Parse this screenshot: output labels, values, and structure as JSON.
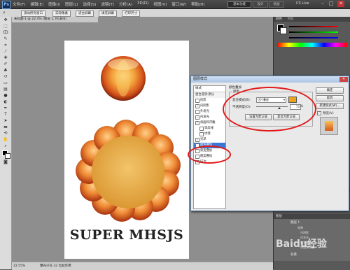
{
  "app": {
    "logo": "Ps"
  },
  "menubar": {
    "menus": [
      "文件(F)",
      "编辑(E)",
      "图像(I)",
      "图层(L)",
      "选择(S)",
      "滤镜(T)",
      "分析(A)",
      "3D(D)",
      "视图(V)",
      "窗口(W)",
      "帮助(H)"
    ],
    "workspace": "基本功能",
    "ws_design": "设计",
    "ws_paint": "绘画",
    "cs_live": "CS Live",
    "minimize": "–",
    "maximize": "□",
    "close": "✕"
  },
  "optbar": {
    "b1": "滚动所有窗口",
    "b2": "实际像素",
    "b3": "适合屏幕",
    "b4": "填充屏幕",
    "b5": "打印尺寸"
  },
  "document": {
    "tab": "未标题-1 @ 22.4% (图层 1, RGB/8)",
    "zoom": "22.55%",
    "doc_info": "曝光只在 32 位起作用",
    "artwork_text": "SUPER MHSJS"
  },
  "panels": {
    "color_tab": "颜色",
    "swatch_tab": "色板",
    "adjust_tab": "调整",
    "layers_tab": "图层",
    "layer_name": "图层 1",
    "effects": [
      "效果",
      "内阴影",
      "内发光",
      "外发光",
      "斜面和浮雕"
    ],
    "bg_layer": "背景"
  },
  "dialog": {
    "title": "图层样式",
    "close": "✕",
    "styles_header": "样式",
    "blend_options": "混合选项:默认",
    "items": [
      {
        "label": "投影",
        "checked": false
      },
      {
        "label": "内阴影",
        "checked": true
      },
      {
        "label": "外发光",
        "checked": false
      },
      {
        "label": "内发光",
        "checked": true
      },
      {
        "label": "斜面和浮雕",
        "checked": true
      },
      {
        "label": "等高线",
        "checked": false,
        "indent": true
      },
      {
        "label": "纹理",
        "checked": false,
        "indent": true
      },
      {
        "label": "光泽",
        "checked": true
      },
      {
        "label": "颜色叠加",
        "checked": true,
        "selected": true
      },
      {
        "label": "渐变叠加",
        "checked": false
      },
      {
        "label": "图案叠加",
        "checked": false
      },
      {
        "label": "描边",
        "checked": false
      }
    ],
    "section_title": "颜色叠加",
    "group_title": "颜色",
    "blend_mode_label": "混合模式(B):",
    "blend_mode_value": "正片叠底",
    "opacity_label": "不透明度(O):",
    "opacity_value": "73",
    "opacity_unit": "%",
    "overlay_color": "#f0a21a",
    "btn_default": "设置为默认值",
    "btn_reset": "复位为默认值",
    "btn_ok": "确定",
    "btn_cancel": "取消",
    "btn_new_style": "新建样式(W)...",
    "preview_label": "预览(V)",
    "preview_checked": true
  },
  "colors": {
    "highlight": "#e21b1b",
    "selected_item": "#3b78d6"
  },
  "watermark": "Baidu经验"
}
